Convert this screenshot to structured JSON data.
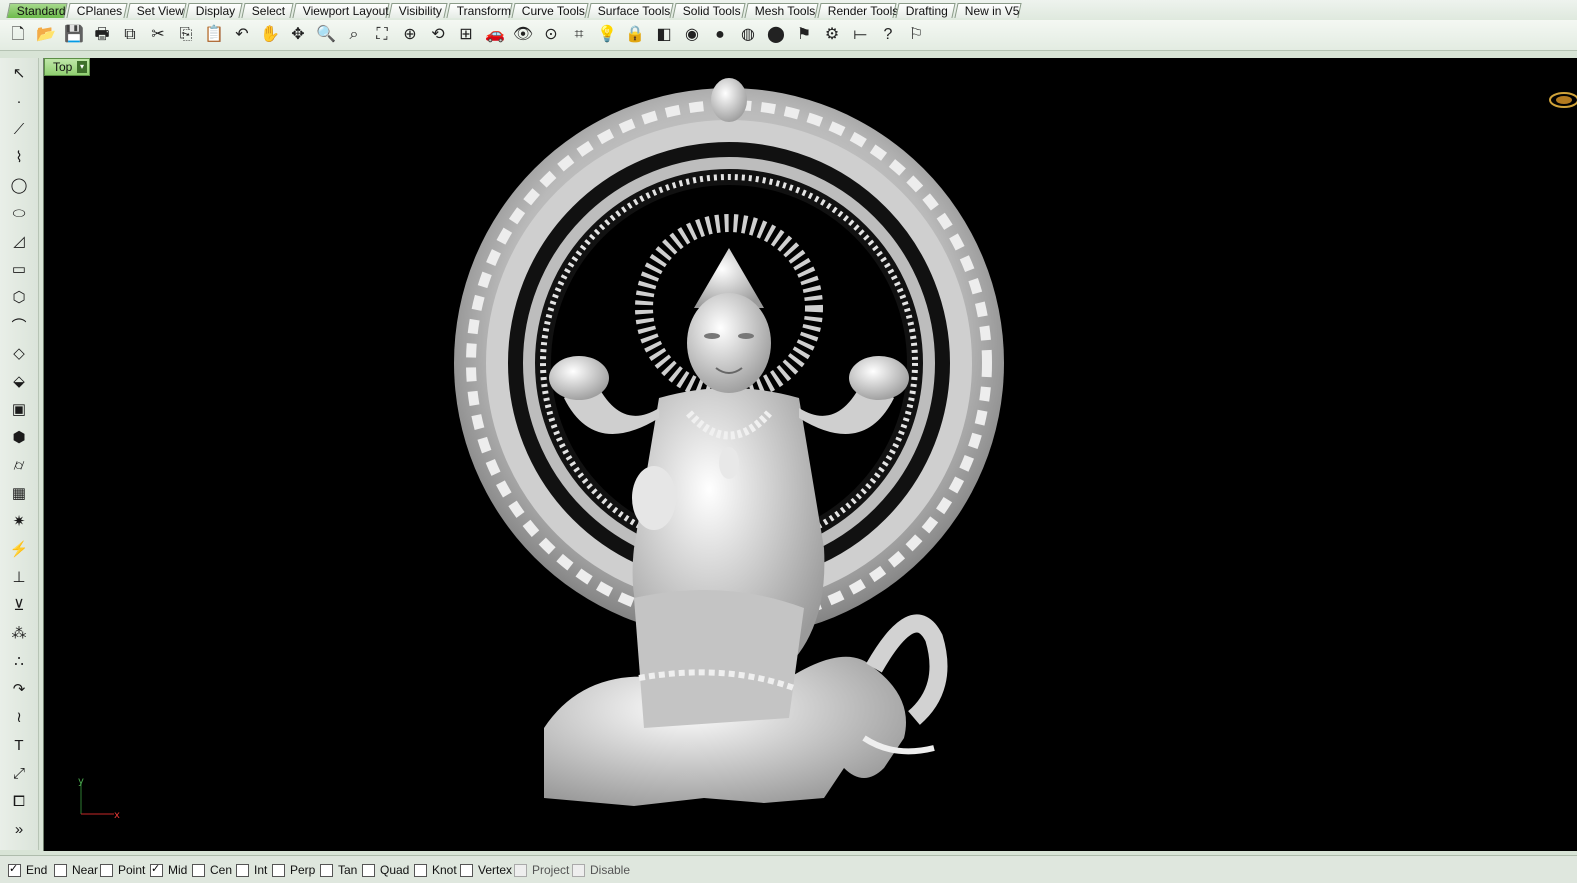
{
  "tabs": [
    "Standard",
    "CPlanes",
    "Set View",
    "Display",
    "Select",
    "Viewport Layout",
    "Visibility",
    "Transform",
    "Curve Tools",
    "Surface Tools",
    "Solid Tools",
    "Mesh Tools",
    "Render Tools",
    "Drafting",
    "New in V5"
  ],
  "active_tab": "Standard",
  "toolbar_icons": [
    {
      "name": "new-file-icon",
      "glyph": "🗋"
    },
    {
      "name": "open-file-icon",
      "glyph": "📂"
    },
    {
      "name": "save-icon",
      "glyph": "💾"
    },
    {
      "name": "print-icon",
      "glyph": "🖶"
    },
    {
      "name": "import-icon",
      "glyph": "⧉"
    },
    {
      "name": "cut-icon",
      "glyph": "✂"
    },
    {
      "name": "copy-icon",
      "glyph": "⎘"
    },
    {
      "name": "paste-icon",
      "glyph": "📋"
    },
    {
      "name": "undo-icon",
      "glyph": "↶"
    },
    {
      "name": "pan-hand-icon",
      "glyph": "✋"
    },
    {
      "name": "rotate-view-icon",
      "glyph": "✥"
    },
    {
      "name": "zoom-dynamic-icon",
      "glyph": "🔍"
    },
    {
      "name": "zoom-window-icon",
      "glyph": "⌕"
    },
    {
      "name": "zoom-extents-icon",
      "glyph": "⛶"
    },
    {
      "name": "zoom-selected-icon",
      "glyph": "⊕"
    },
    {
      "name": "undo-view-icon",
      "glyph": "⟲"
    },
    {
      "name": "four-viewports-icon",
      "glyph": "⊞"
    },
    {
      "name": "car-icon",
      "glyph": "🚗"
    },
    {
      "name": "eye-icon",
      "glyph": "👁"
    },
    {
      "name": "circle-point-icon",
      "glyph": "⊙"
    },
    {
      "name": "snap-grid-icon",
      "glyph": "⌗"
    },
    {
      "name": "light-bulb-icon",
      "glyph": "💡"
    },
    {
      "name": "lock-icon",
      "glyph": "🔒"
    },
    {
      "name": "layer-icon",
      "glyph": "◧"
    },
    {
      "name": "color-wheel-icon",
      "glyph": "◉"
    },
    {
      "name": "shaded-sphere-icon",
      "glyph": "●"
    },
    {
      "name": "rendered-sphere-icon",
      "glyph": "◍"
    },
    {
      "name": "blue-sphere-icon",
      "glyph": "⬤"
    },
    {
      "name": "flag-icon",
      "glyph": "⚑"
    },
    {
      "name": "options-gear-icon",
      "glyph": "⚙"
    },
    {
      "name": "dimension-icon",
      "glyph": "⟝"
    },
    {
      "name": "help-icon",
      "glyph": "?"
    },
    {
      "name": "tooltip-icon",
      "glyph": "⚐"
    }
  ],
  "left_tools": [
    {
      "name": "select-arrow-icon",
      "glyph": "↖"
    },
    {
      "name": "point-icon",
      "glyph": "·"
    },
    {
      "name": "polyline-icon",
      "glyph": "⟋"
    },
    {
      "name": "curve-control-points-icon",
      "glyph": "⌇"
    },
    {
      "name": "circle-icon",
      "glyph": "◯"
    },
    {
      "name": "ellipse-icon",
      "glyph": "⬭"
    },
    {
      "name": "arc-icon",
      "glyph": "◿"
    },
    {
      "name": "rectangle-icon",
      "glyph": "▭"
    },
    {
      "name": "polygon-icon",
      "glyph": "⬡"
    },
    {
      "name": "fillet-curve-icon",
      "glyph": "⌒"
    },
    {
      "name": "surface-from-points-icon",
      "glyph": "◇"
    },
    {
      "name": "extrude-surface-icon",
      "glyph": "⬙"
    },
    {
      "name": "box-solid-icon",
      "glyph": "▣"
    },
    {
      "name": "boolean-union-icon",
      "glyph": "⬢"
    },
    {
      "name": "cylinder-icon",
      "glyph": "⌭"
    },
    {
      "name": "mesh-plane-icon",
      "glyph": "▦"
    },
    {
      "name": "transform-gear-icon",
      "glyph": "✷"
    },
    {
      "name": "trim-icon",
      "glyph": "⚡"
    },
    {
      "name": "split-icon",
      "glyph": "⊥"
    },
    {
      "name": "explode-icon",
      "glyph": "⊻"
    },
    {
      "name": "group-icon",
      "glyph": "⁂"
    },
    {
      "name": "move-icon",
      "glyph": "∴"
    },
    {
      "name": "curve-blend-icon",
      "glyph": "↷"
    },
    {
      "name": "rebuild-curve-icon",
      "glyph": "≀"
    },
    {
      "name": "text-icon",
      "glyph": "T"
    },
    {
      "name": "dimension-align-icon",
      "glyph": "⤢"
    },
    {
      "name": "block-icon",
      "glyph": "⧠"
    },
    {
      "name": "more-tools-icon",
      "glyph": "»"
    }
  ],
  "viewport": {
    "label": "Top",
    "dropdown_glyph": "▾"
  },
  "axis": {
    "y": "y",
    "x": "x"
  },
  "snaps": [
    {
      "label": "End",
      "checked": true,
      "disabled": false
    },
    {
      "label": "Near",
      "checked": false,
      "disabled": false
    },
    {
      "label": "Point",
      "checked": false,
      "disabled": false
    },
    {
      "label": "Mid",
      "checked": true,
      "disabled": false
    },
    {
      "label": "Cen",
      "checked": false,
      "disabled": false
    },
    {
      "label": "Int",
      "checked": false,
      "disabled": false
    },
    {
      "label": "Perp",
      "checked": false,
      "disabled": false
    },
    {
      "label": "Tan",
      "checked": false,
      "disabled": false
    },
    {
      "label": "Quad",
      "checked": false,
      "disabled": false
    },
    {
      "label": "Knot",
      "checked": false,
      "disabled": false
    },
    {
      "label": "Vertex",
      "checked": false,
      "disabled": false
    },
    {
      "label": "Project",
      "checked": false,
      "disabled": true
    },
    {
      "label": "Disable",
      "checked": false,
      "disabled": true
    }
  ],
  "colors": {
    "active_tab": "#6dbb4c",
    "viewport_bg": "#000000",
    "model": "#d9d9d9"
  }
}
